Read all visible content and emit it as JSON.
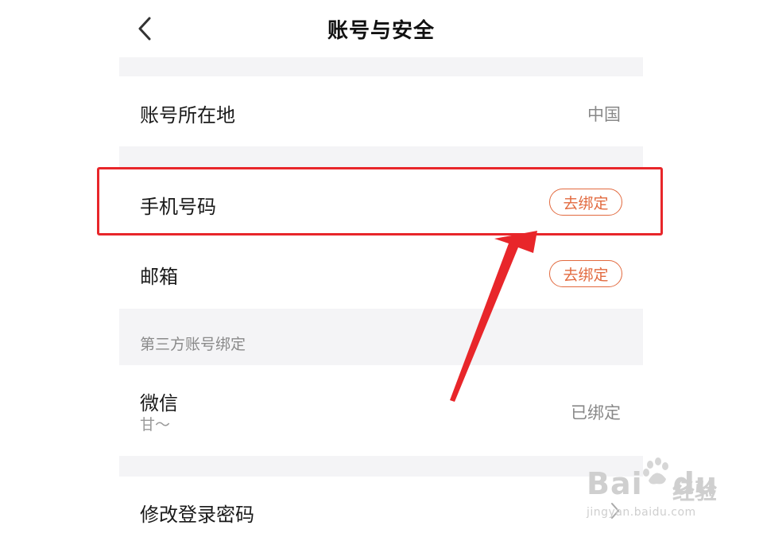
{
  "header": {
    "title": "账号与安全",
    "back_icon": "chevron-left-icon"
  },
  "rows": {
    "region": {
      "label": "账号所在地",
      "value": "中国"
    },
    "phone": {
      "label": "手机号码",
      "action": "去绑定"
    },
    "email": {
      "label": "邮箱",
      "action": "去绑定"
    },
    "third_party_section": "第三方账号绑定",
    "wechat": {
      "label": "微信",
      "sublabel": "甘～",
      "value": "已绑定"
    },
    "password": {
      "label": "修改登录密码",
      "icon": "chevron-right-icon"
    }
  },
  "annotation": {
    "highlight_color": "#e8262a"
  },
  "watermark": {
    "main": "Bai",
    "main2": "du",
    "cn": "经验",
    "url": "jingyan.baidu.com"
  },
  "colors": {
    "accent": "#e26a3f",
    "divider": "#f4f4f6",
    "muted_text": "#888888"
  }
}
